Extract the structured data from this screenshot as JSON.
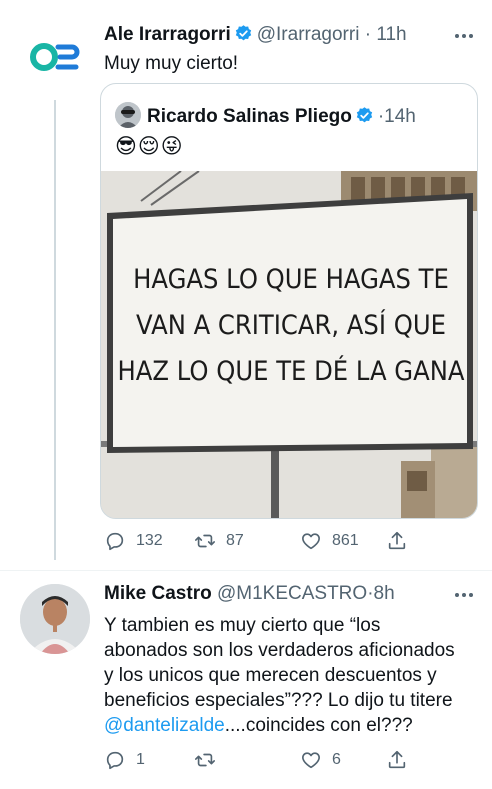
{
  "tweets": [
    {
      "author_name": "Ale Irarragorri",
      "handle": "@Irarragorri",
      "dot": "·",
      "time": "11h",
      "text": "Muy muy cierto!",
      "quote": {
        "author_name": "Ricardo Salinas Pliego",
        "dot": "·",
        "time": "14h",
        "emoji_text": "😎😌😜",
        "billboard_lines": [
          "HAGAS LO QUE HAGAS TE",
          "VAN A CRITICAR, ASÍ QUE",
          "HAZ LO QUE TE DÉ LA GANA"
        ]
      },
      "stats": {
        "replies": "132",
        "retweets": "87",
        "likes": "861"
      }
    },
    {
      "author_name": "Mike Castro",
      "handle": "@M1KECASTRO",
      "dot": "·",
      "time": "8h",
      "text_lines": [
        "Y tambien es muy cierto que “los",
        "abonados son los verdaderos aficionados",
        "y los unicos que merecen descuentos y",
        "beneficios especiales”??? Lo dijo tu titere"
      ],
      "mention": "@dantelizalde",
      "text_tail": "....coincides con el???",
      "stats": {
        "replies": "1",
        "retweets": "",
        "likes": "6"
      }
    }
  ],
  "colors": {
    "accent": "#1d9bf0",
    "secondary_text": "#536471",
    "border": "#cfd9de",
    "logo_teal": "#19b5a5",
    "logo_blue": "#1f7bd8"
  },
  "icons": [
    "verified-badge-icon",
    "more-icon",
    "reply-icon",
    "retweet-icon",
    "like-icon",
    "share-icon"
  ]
}
